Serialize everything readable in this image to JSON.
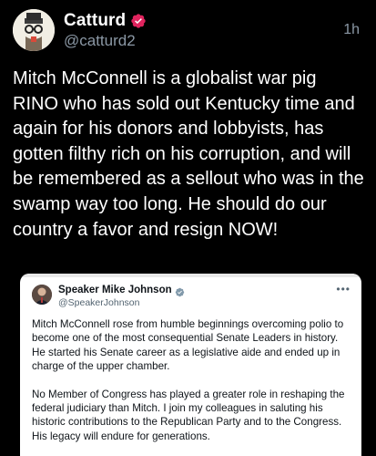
{
  "post": {
    "author_name": "Catturd",
    "author_handle": "@catturd2",
    "timestamp": "1h",
    "text": "Mitch McConnell is a globalist war pig RINO who has sold out Kentucky time and again for his donors and lobbyists, has gotten filthy rich on his corruption, and will be remembered as a sellout who was in the swamp way too long. He should do our country a favor and resign NOW!",
    "verified_color": "#e0245e"
  },
  "quoted": {
    "author_name": "Speaker Mike Johnson",
    "author_handle": "@SpeakerJohnson",
    "more_label": "•••",
    "paragraph_1": "Mitch McConnell rose from humble beginnings overcoming polio to become one of the most consequential Senate Leaders in history. He started his Senate career as a legislative aide and ended up in charge of the upper chamber.",
    "paragraph_2": "No Member of Congress has played a greater role in reshaping the federal judiciary than Mitch. I join my colleagues in saluting his historic contributions to the Republican Party and to the Congress. His legacy will endure for generations.",
    "verified_color": "#829aab"
  },
  "icons": {
    "post_badge": "verified-badge-icon",
    "quote_badge": "verified-badge-icon"
  }
}
